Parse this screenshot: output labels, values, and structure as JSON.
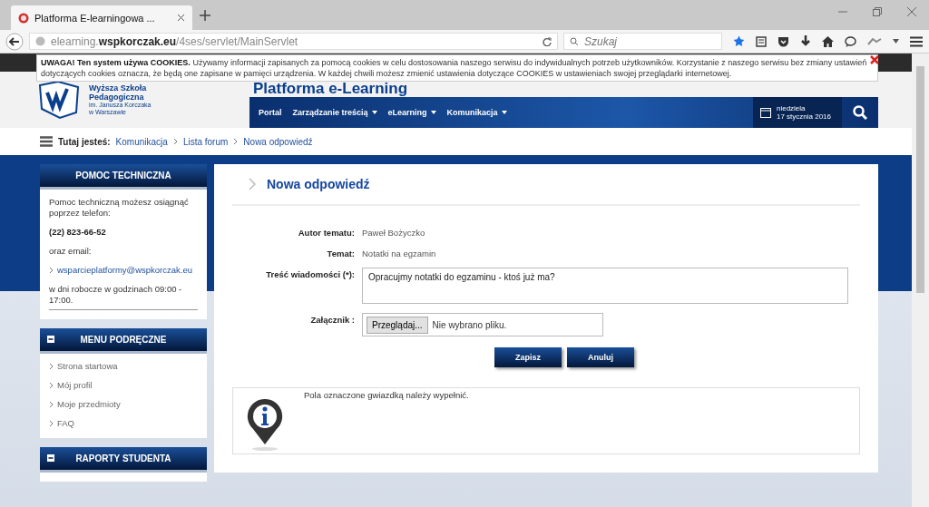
{
  "browser": {
    "tab_title": "Platforma E-learningowa ...",
    "url": "elearning.**wspkorczak.eu**/4ses/servlet/MainServlet",
    "search_placeholder": "Szukaj"
  },
  "cookie_notice": {
    "text": "**UWAGA! Ten system używa COOKIES.** Używamy informacji zapisanych za pomocą cookies w celu dostosowania naszego serwisu do indywidualnych potrzeb użytkowników. Korzystanie z naszego serwisu bez zmiany ustawień dotyczących cookies oznacza, że będą one zapisane w pamięci urządzenia. W każdej chwili możesz zmienić ustawienia dotyczące COOKIES w ustawieniach swojej przeglądarki internetowej."
  },
  "header": {
    "logo_lines": [
      "Wyższa Szkoła",
      "Pedagogiczna",
      "im. Janusza Korczaka",
      "w Warszawie"
    ],
    "title": "Platforma e-Learning",
    "nav": [
      {
        "label": "Portal",
        "dropdown": false
      },
      {
        "label": "Zarządzanie treścią",
        "dropdown": true
      },
      {
        "label": "eLearning",
        "dropdown": true
      },
      {
        "label": "Komunikacja",
        "dropdown": true
      }
    ],
    "weekday": "niedziela",
    "date": "17 stycznia 2016"
  },
  "breadcrumb": {
    "label": "Tutaj jesteś:",
    "items": [
      "Komunikacja",
      "Lista forum",
      "Nowa odpowiedź"
    ]
  },
  "sidebar": [
    {
      "title": "POMOC TECHNICZNA",
      "collapsible": false,
      "lines": [
        {
          "kind": "text",
          "text": "Pomoc techniczną możesz osiągnąć poprzez telefon:"
        },
        {
          "kind": "bold",
          "text": "(22) 823-66-52"
        },
        {
          "kind": "text",
          "text": "oraz email:"
        },
        {
          "kind": "link",
          "text": "wsparcieplatformy@wspkorczak.eu"
        },
        {
          "kind": "text",
          "text": "w dni robocze w godzinach 09:00 - 17:00."
        }
      ]
    },
    {
      "title": "MENU PODRĘCZNE",
      "collapsible": true,
      "lines": [
        {
          "kind": "link",
          "text": "Strona startowa"
        },
        {
          "kind": "link",
          "text": "Mój profil"
        },
        {
          "kind": "link",
          "text": "Moje przedmioty"
        },
        {
          "kind": "link",
          "text": "FAQ"
        }
      ]
    },
    {
      "title": "RAPORTY STUDENTA",
      "collapsible": true
    }
  ],
  "main": {
    "heading": "Nowa odpowiedź",
    "fields": [
      {
        "kind": "text",
        "label": "Autor tematu:",
        "value": "Paweł Bożyczko"
      },
      {
        "kind": "text",
        "label": "Temat:",
        "value": "Notatki na egzamin"
      },
      {
        "kind": "textarea",
        "label": "Treść wiadomości (*):",
        "value": "Opracujmy notatki do egzaminu - ktoś już ma?"
      },
      {
        "kind": "file",
        "label": "Załącznik :",
        "button": "Przeglądaj...",
        "value": "Nie wybrano pliku."
      }
    ],
    "buttons": [
      "Zapisz",
      "Anuluj"
    ],
    "info": "Pola oznaczone gwiazdką należy wypełnić."
  }
}
